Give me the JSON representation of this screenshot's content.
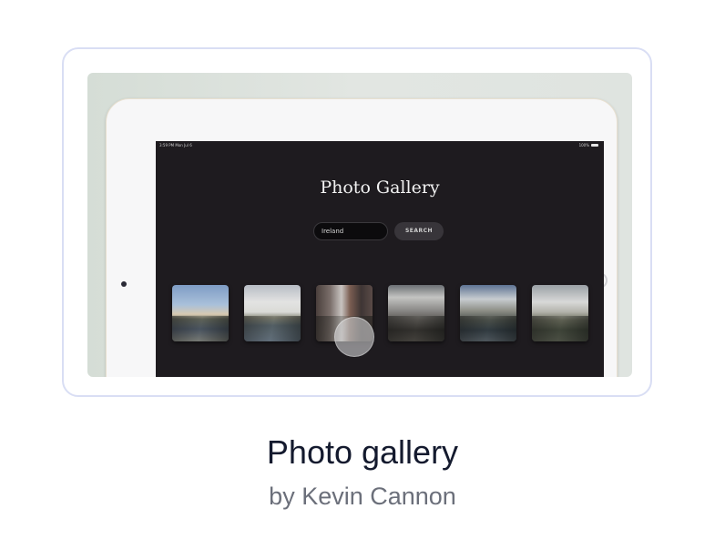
{
  "preview": {
    "status_bar": {
      "time_date": "3:59 PM  Mon Jul 6",
      "battery": "100%"
    },
    "app_title": "Photo Gallery",
    "search": {
      "value": "Ireland",
      "button_label": "SEARCH"
    },
    "thumbnails": [
      {
        "name": "cliffs-coast-photo"
      },
      {
        "name": "sea-stack-cliffs-photo"
      },
      {
        "name": "street-buildings-photo"
      },
      {
        "name": "rocky-shore-photo"
      },
      {
        "name": "castle-coast-photo"
      },
      {
        "name": "green-cliffs-photo"
      }
    ]
  },
  "caption": {
    "title": "Photo gallery",
    "author": "by Kevin Cannon"
  },
  "colors": {
    "card_border": "#d9def4",
    "screen_background": "#1e1b1f",
    "title_text": "#141a2e",
    "author_text": "#6b6f7a"
  }
}
